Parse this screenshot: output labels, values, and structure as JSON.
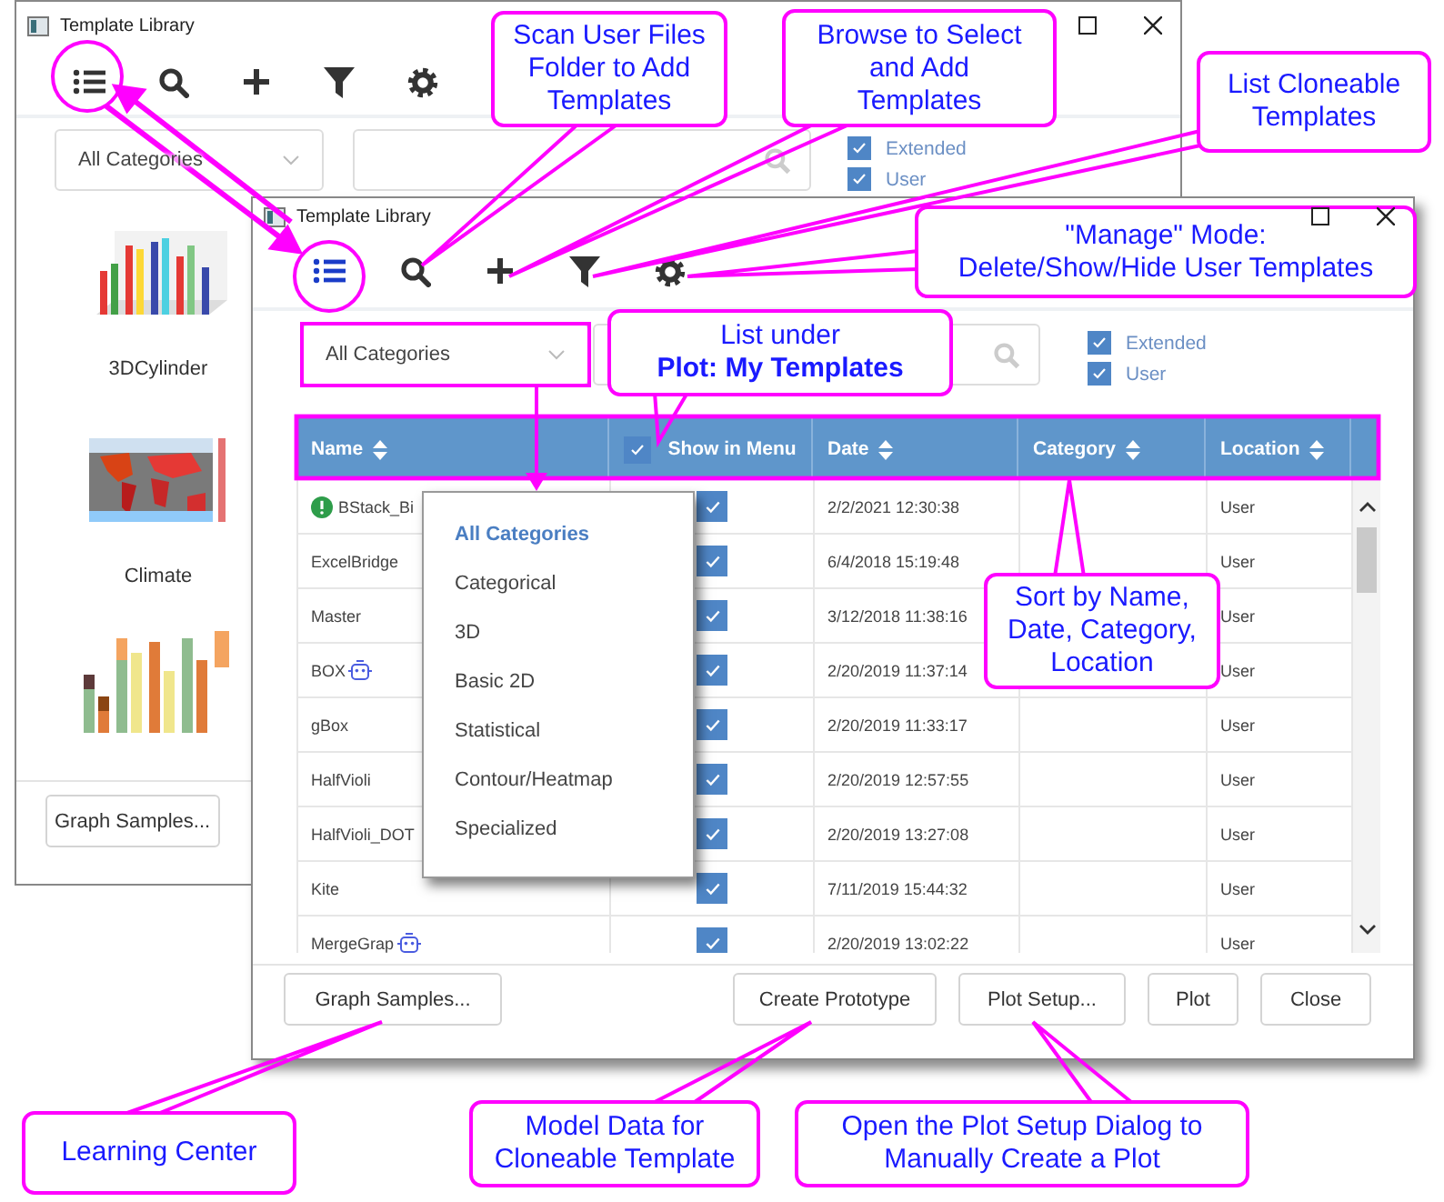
{
  "back_window": {
    "title": "Template Library",
    "category_dropdown": "All Categories",
    "filters": [
      {
        "label": "Extended",
        "checked": true
      },
      {
        "label": "User",
        "checked": true
      }
    ],
    "thumbnails": [
      {
        "kind": "picture",
        "label": "3DCylinder"
      },
      {
        "kind": "picture",
        "label": "Climate"
      },
      {
        "kind": "picture"
      }
    ],
    "buttons": [
      "Graph Samples..."
    ]
  },
  "front_window": {
    "title": "Template Library",
    "category_dropdown": "All Categories",
    "filters": [
      {
        "label": "Extended",
        "checked": true
      },
      {
        "label": "User",
        "checked": true
      }
    ],
    "table": {
      "columns": [
        {
          "label": "Name",
          "sortable": true
        },
        {
          "label": "Show in Menu",
          "sortable": false,
          "checked": true
        },
        {
          "label": "Date",
          "sortable": true
        },
        {
          "label": "Category",
          "sortable": true
        },
        {
          "label": "Location",
          "sortable": true
        }
      ],
      "rows": [
        {
          "name": "BStack_Bi",
          "kind": "alert",
          "show_in_menu": true,
          "date": "2/2/2021 12:30:38",
          "location": "User"
        },
        {
          "name": "ExcelBridge",
          "kind": "plain",
          "show_in_menu": true,
          "date": "6/4/2018 15:19:48",
          "location": "User"
        },
        {
          "name": "Master",
          "kind": "plain",
          "show_in_menu": true,
          "date": "3/12/2018 11:38:16",
          "location": "User"
        },
        {
          "name": "BOX",
          "kind": "cloneable",
          "show_in_menu": true,
          "date": "2/20/2019 11:37:14",
          "location": "User"
        },
        {
          "name": "gBox",
          "kind": "plain",
          "show_in_menu": true,
          "date": "2/20/2019 11:33:17",
          "location": "User"
        },
        {
          "name": "HalfVioli",
          "kind": "plain",
          "show_in_menu": true,
          "date": "2/20/2019 12:57:55",
          "location": "User"
        },
        {
          "name": "HalfVioli_DOT",
          "kind": "plain",
          "show_in_menu": true,
          "date": "2/20/2019 13:27:08",
          "location": "User"
        },
        {
          "name": "Kite",
          "kind": "plain",
          "show_in_menu": true,
          "date": "7/11/2019 15:44:32",
          "location": "User"
        },
        {
          "name": "MergeGrap",
          "kind": "cloneable",
          "show_in_menu": true,
          "date": "2/20/2019 13:02:22",
          "location": "User"
        }
      ]
    },
    "category_menu": {
      "items": [
        {
          "label": "All Categories",
          "selected": true
        },
        {
          "label": "Categorical",
          "selected": false
        },
        {
          "label": "3D",
          "selected": false
        },
        {
          "label": "Basic 2D",
          "selected": false
        },
        {
          "label": "Statistical",
          "selected": false
        },
        {
          "label": "Contour/Heatmap",
          "selected": false
        },
        {
          "label": "Specialized",
          "selected": false
        }
      ]
    },
    "buttons": [
      "Graph Samples...",
      "Create Prototype",
      "Plot Setup...",
      "Plot",
      "Close"
    ]
  },
  "callouts": [
    {
      "text": "Scan User Files\nFolder to Add\nTemplates"
    },
    {
      "text": "Browse to Select\nand Add\nTemplates"
    },
    {
      "text": "List Cloneable\nTemplates"
    },
    {
      "text": "\"Manage\" Mode:\nDelete/Show/Hide User Templates"
    },
    {
      "text": "List under\n**Plot: My Templates**"
    },
    {
      "text": "Sort by Name,\nDate, Category,\nLocation"
    },
    {
      "text": "Learning Center"
    },
    {
      "text": "Model Data for\nCloneable Template"
    },
    {
      "text": "Open the Plot Setup Dialog to\nManually Create a Plot"
    }
  ]
}
